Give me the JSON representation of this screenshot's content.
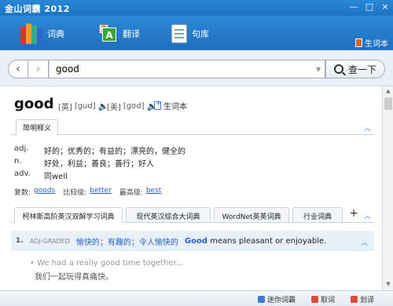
{
  "window": {
    "title": "金山词霸 2012",
    "min": "—",
    "max": "□",
    "close": "×"
  },
  "nav": {
    "dict": "词典",
    "translate": "翻译",
    "sentences": "句库",
    "wordbook": "生词本"
  },
  "search": {
    "value": "good",
    "button": "查一下"
  },
  "entry": {
    "word": "good",
    "uk_label": "[英]",
    "uk_phonetic": "[gud]",
    "us_label": "[美]",
    "us_phonetic": "[gʊd]",
    "add_wordbook": "生词本"
  },
  "basic_tab": "简明释义",
  "definitions": [
    {
      "pos": "adj.",
      "text": "好的；优秀的；有益的；漂亮的，健全的"
    },
    {
      "pos": "n.",
      "text": "好处，利益；善良；善行；好人"
    },
    {
      "pos": "adv.",
      "text": "同well"
    }
  ],
  "forms": {
    "plural_label": "复数:",
    "plural": "goods",
    "comparative_label": "比较级:",
    "comparative": "better",
    "superlative_label": "最高级:",
    "superlative": "best"
  },
  "dict_tabs": [
    {
      "label": "柯林斯高阶英汉双解学习词典",
      "active": true
    },
    {
      "label": "现代英汉综合大词典",
      "active": false
    },
    {
      "label": "WordNet英英词典",
      "active": false
    },
    {
      "label": "行业词典",
      "active": false
    }
  ],
  "collins": {
    "num": "1.",
    "tag": "ADJ-GRADED",
    "cn": "愉快的；有趣的；令人愉快的",
    "en_word": "Good",
    "en_rest": " means pleasant or enjoyable."
  },
  "example": {
    "en": "We had a really good time together...",
    "cn": "我们一起玩得真痛快。"
  },
  "status": {
    "mini": "迷你词霸",
    "fetch": "取词",
    "select": "划译"
  }
}
